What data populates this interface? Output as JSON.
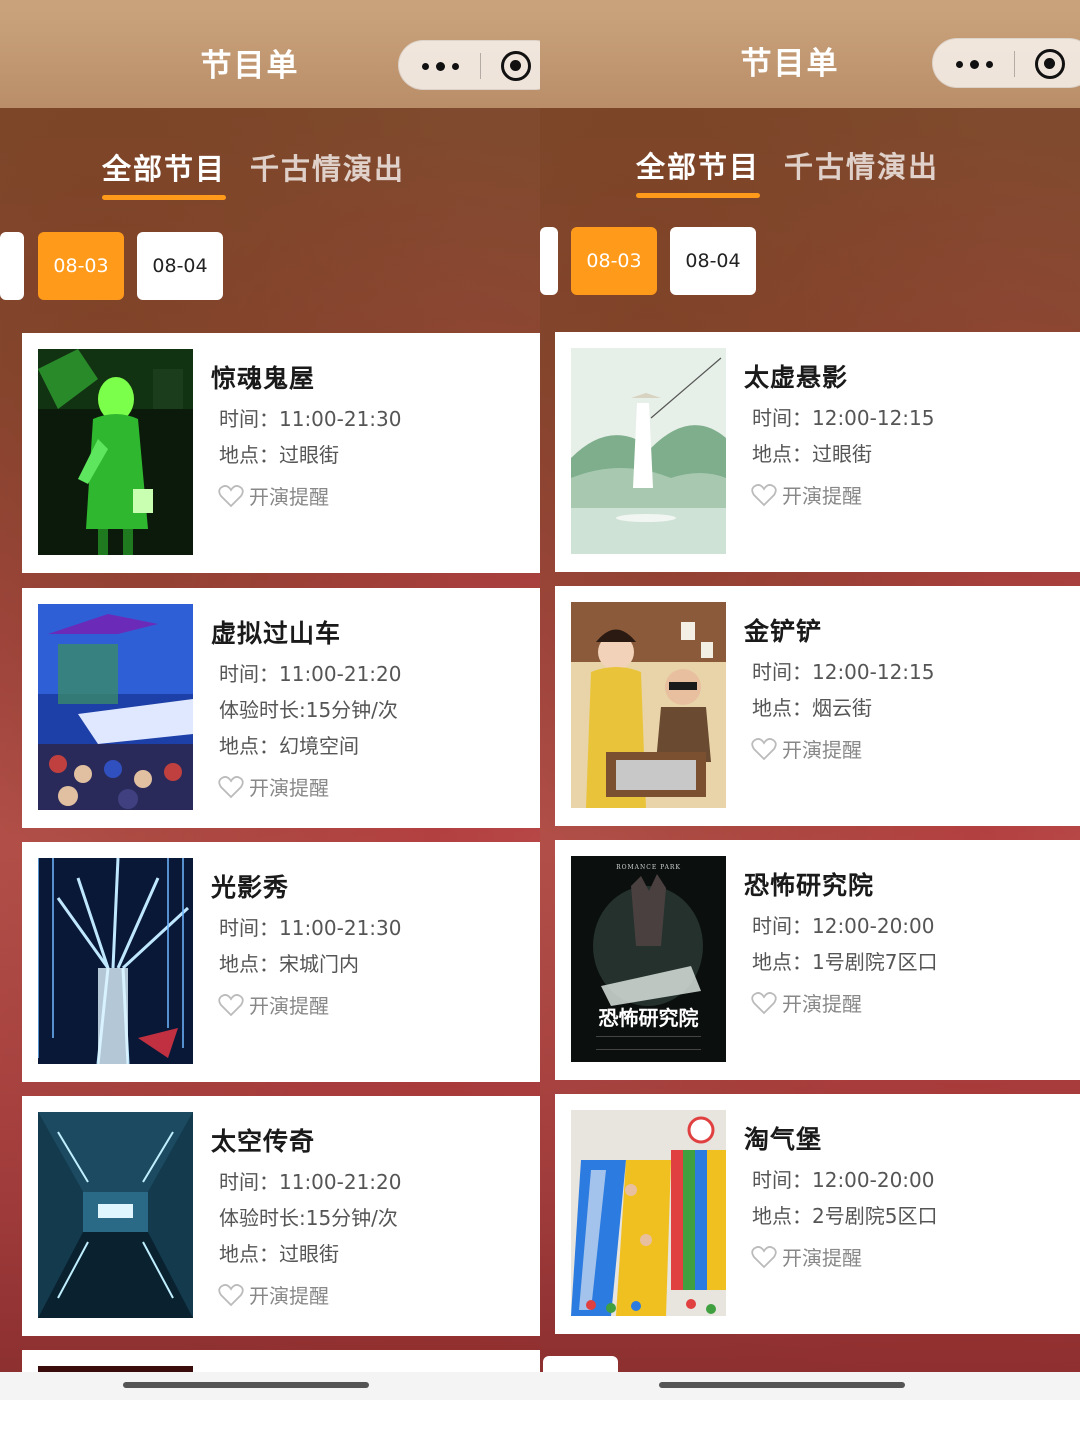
{
  "left_panel": {
    "nav": {
      "title": "节目单"
    },
    "tabs": [
      {
        "label": "全部节目",
        "active": true
      },
      {
        "label": "千古情演出",
        "active": false
      }
    ],
    "dates": [
      {
        "label": "08-03",
        "active": true
      },
      {
        "label": "08-04",
        "active": false
      }
    ],
    "programs": [
      {
        "name": "惊魂鬼屋",
        "lines": [
          "时间：11:00-21:30",
          "地点：过眼街"
        ],
        "reminder": "开演提醒",
        "image": "green-ghost-house"
      },
      {
        "name": "虚拟过山车",
        "lines": [
          "时间：11:00-21:20",
          "体验时长:15分钟/次",
          "地点：幻境空间"
        ],
        "reminder": "开演提醒",
        "image": "blue-vr-coaster"
      },
      {
        "name": "光影秀",
        "lines": [
          "时间：11:00-21:30",
          "地点：宋城门内"
        ],
        "reminder": "开演提醒",
        "image": "light-tree"
      },
      {
        "name": "太空传奇",
        "lines": [
          "时间：11:00-21:20",
          "体验时长:15分钟/次",
          "地点：过眼街"
        ],
        "reminder": "开演提醒",
        "image": "space-corridor"
      }
    ]
  },
  "right_panel": {
    "nav": {
      "title": "节目单"
    },
    "tabs": [
      {
        "label": "全部节目",
        "active": true
      },
      {
        "label": "千古情演出",
        "active": false
      }
    ],
    "dates": [
      {
        "label": "08-03",
        "active": true
      },
      {
        "label": "08-04",
        "active": false
      }
    ],
    "programs": [
      {
        "name": "太虚悬影",
        "lines": [
          "时间：12:00-12:15",
          "地点：过眼街"
        ],
        "reminder": "开演提醒",
        "image": "fisherman-mist"
      },
      {
        "name": "金铲铲",
        "lines": [
          "时间：12:00-12:15",
          "地点：烟云街"
        ],
        "reminder": "开演提醒",
        "image": "golden-shovel-illustration"
      },
      {
        "name": "恐怖研究院",
        "lines": [
          "时间：12:00-20:00",
          "地点：1号剧院7区口"
        ],
        "reminder": "开演提醒",
        "image": "horror-institute-poster",
        "poster_text": {
          "top": "ROMANCE PARK",
          "title": "恐怖研究院"
        }
      },
      {
        "name": "淘气堡",
        "lines": [
          "时间：12:00-20:00",
          "地点：2号剧院5区口"
        ],
        "reminder": "开演提醒",
        "image": "playground-slide"
      }
    ]
  },
  "icons": {
    "more": "more-dots-icon",
    "close": "target-close-icon",
    "heart": "heart-outline-icon"
  },
  "colors": {
    "accent": "#ff9a1a",
    "nav_bg": "#c9a27c",
    "card_bg": "#ffffff",
    "title_text": "#1a1a1a",
    "body_text": "#555555"
  }
}
